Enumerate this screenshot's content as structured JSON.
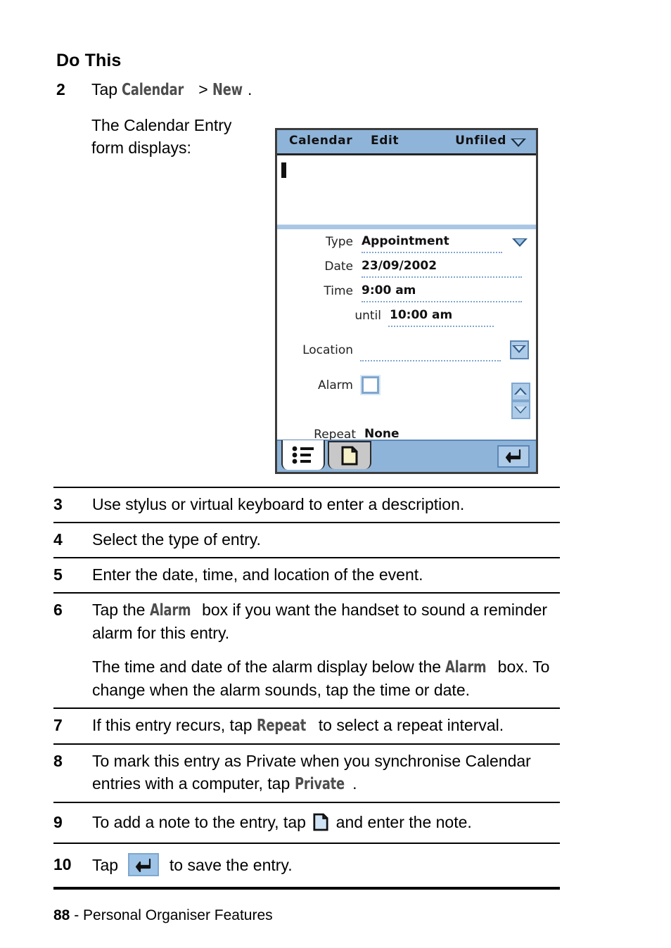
{
  "heading": "Do This",
  "step2": {
    "number": "2",
    "text_before": "Tap ",
    "term_calendar": "Calendar",
    "text_mid": " > ",
    "term_new": "New",
    "text_after": ".",
    "caption": "The Calendar Entry form displays:"
  },
  "device": {
    "titlebar": {
      "app": "Calendar",
      "menu": "Edit",
      "category": "Unfiled",
      "caret_icon": "chevron-down-icon"
    },
    "description_value": "",
    "fields": [
      {
        "label": "Type",
        "value": "Appointment",
        "control": "dropdown-caret"
      },
      {
        "label": "Date",
        "value": "23/09/2002",
        "control": "none"
      },
      {
        "label": "Time",
        "value": "9:00 am",
        "control": "none"
      },
      {
        "label": "until",
        "value": "10:00 am",
        "control": "none"
      },
      {
        "label": "Location",
        "value": "",
        "control": "picker-button"
      },
      {
        "label": "Alarm",
        "value": "",
        "control": "checkbox-unchecked"
      },
      {
        "label": "Repeat",
        "value": "None",
        "control": "none"
      }
    ],
    "scroll": {
      "up_icon": "scroll-up-icon",
      "down_icon": "scroll-down-icon"
    },
    "toolbar": {
      "tab_details_icon": "bulleted-list-icon",
      "tab_note_icon": "note-page-icon",
      "save_icon": "return-arrow-icon"
    }
  },
  "steps": [
    {
      "number": "3",
      "paragraphs": [
        [
          {
            "t": "text",
            "v": "Use stylus or virtual keyboard to enter a description."
          }
        ]
      ]
    },
    {
      "number": "4",
      "paragraphs": [
        [
          {
            "t": "text",
            "v": "Select the type of entry."
          }
        ]
      ]
    },
    {
      "number": "5",
      "paragraphs": [
        [
          {
            "t": "text",
            "v": "Enter the date, time, and location of the event."
          }
        ]
      ]
    },
    {
      "number": "6",
      "paragraphs": [
        [
          {
            "t": "text",
            "v": "Tap the "
          },
          {
            "t": "term",
            "v": "Alarm"
          },
          {
            "t": "text",
            "v": " box if you want the handset to sound a reminder alarm for this entry."
          }
        ],
        [
          {
            "t": "text",
            "v": "The time and date of the alarm display below the "
          },
          {
            "t": "term",
            "v": "Alarm"
          },
          {
            "t": "text",
            "v": " box. To change when the alarm sounds, tap the time or date."
          }
        ]
      ]
    },
    {
      "number": "7",
      "paragraphs": [
        [
          {
            "t": "text",
            "v": "If this entry recurs, tap "
          },
          {
            "t": "term",
            "v": "Repeat"
          },
          {
            "t": "text",
            "v": " to select a repeat interval."
          }
        ]
      ]
    },
    {
      "number": "8",
      "paragraphs": [
        [
          {
            "t": "text",
            "v": "To mark this entry as Private when you synchronise Calendar entries with a computer, tap "
          },
          {
            "t": "term",
            "v": "Private"
          },
          {
            "t": "text",
            "v": "."
          }
        ]
      ]
    },
    {
      "number": "9",
      "paragraphs": [
        [
          {
            "t": "text",
            "v": "To add a note to the entry, tap "
          },
          {
            "t": "icon",
            "v": "note-page-icon"
          },
          {
            "t": "text",
            "v": " and enter the note."
          }
        ]
      ]
    },
    {
      "number": "10",
      "paragraphs": [
        [
          {
            "t": "text",
            "v": "Tap "
          },
          {
            "t": "icon",
            "v": "return-arrow-button"
          },
          {
            "t": "text",
            "v": " to save the entry."
          }
        ]
      ]
    }
  ],
  "footer": {
    "page_number": "88",
    "separator": " - ",
    "section": "Personal Organiser Features"
  },
  "colors": {
    "titlebar_blue": "#8fb4d9",
    "control_blue": "#aecbe8",
    "divider_blue": "#a9c7e4",
    "term_gray": "#4d4d4d",
    "note_page_fill": "#cfe3f5",
    "note_page_fill_device": "#f5f0c8"
  }
}
